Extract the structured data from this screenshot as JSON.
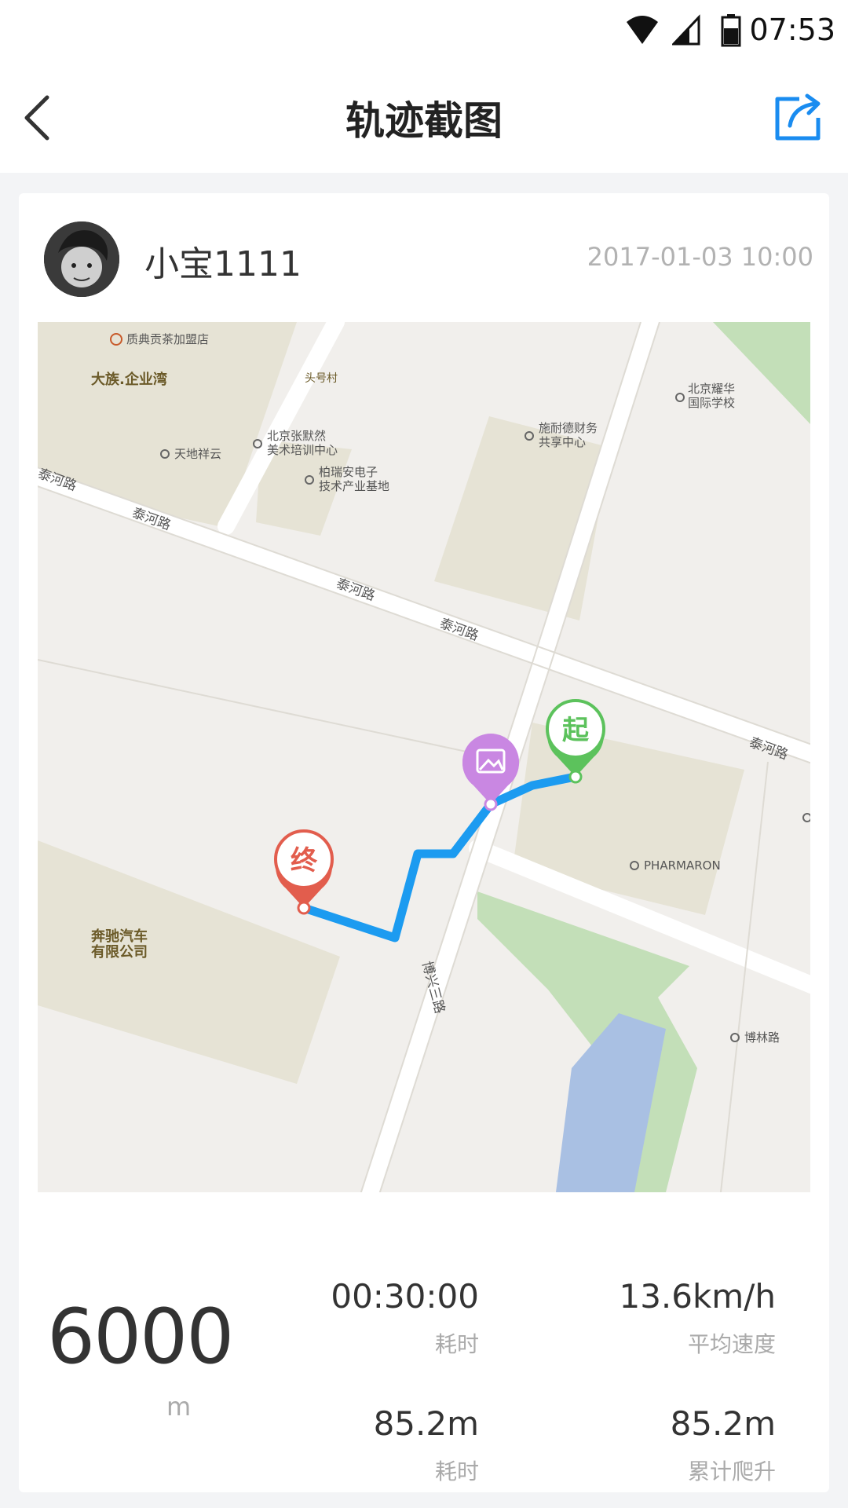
{
  "status_bar": {
    "time": "07:53",
    "icons": [
      "wifi-icon",
      "signal-icon",
      "battery-icon"
    ]
  },
  "header": {
    "title": "轨迹截图",
    "back_icon": "chevron-left-icon",
    "share_icon": "share-icon"
  },
  "card": {
    "username": "小宝1111",
    "datetime": "2017-01-03 10:00"
  },
  "map": {
    "labels": {
      "poi_1": "质典贡茶加盟店",
      "poi_2": "大族.企业湾",
      "poi_3": "头号村",
      "poi_4": "北京耀华",
      "poi_4b": "国际学校",
      "poi_5": "施耐德财务",
      "poi_5b": "共享中心",
      "poi_6": "北京张默然",
      "poi_6b": "美术培训中心",
      "poi_7": "天地祥云",
      "poi_8": "柏瑞安电子",
      "poi_8b": "技术产业基地",
      "road_1": "泰河路",
      "road_2": "泰河路",
      "road_3": "泰河路",
      "road_4": "泰河路",
      "road_5": "泰河路",
      "poi_9": "PHARMARON",
      "poi_10": "奔驰汽车",
      "poi_10b": "有限公司",
      "road_6": "博兴三路",
      "poi_11": "博林路"
    },
    "markers": {
      "start": "起",
      "end": "终",
      "photo_icon": "image-icon"
    },
    "colors": {
      "route": "#1c9bf0",
      "start": "#5cc25c",
      "end": "#e25d4d",
      "photo": "#c987e2"
    }
  },
  "stats": {
    "distance": "6000",
    "distance_unit": "m",
    "duration_value": "00:30:00",
    "duration_label": "耗时",
    "speed_value": "13.6km/h",
    "speed_label": "平均速度",
    "elevation_value": "85.2m",
    "elevation_label": "耗时",
    "climb_value": "85.2m",
    "climb_label": "累计爬升"
  }
}
